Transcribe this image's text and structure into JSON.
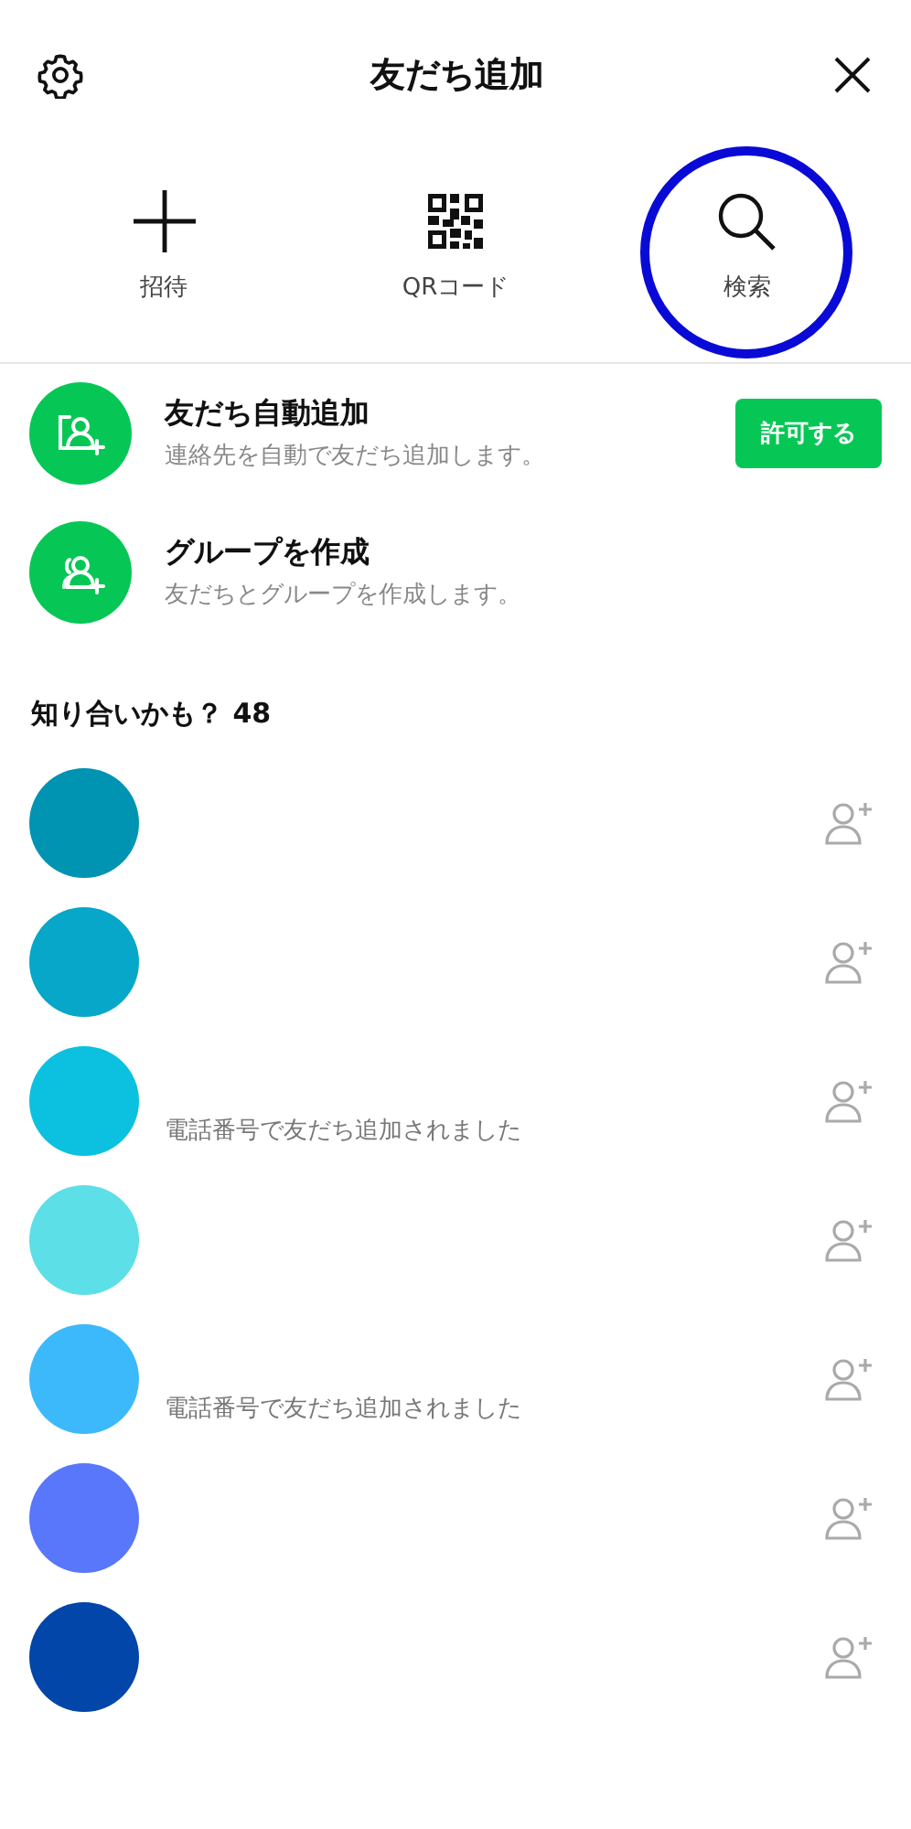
{
  "header": {
    "title": "友だち追加"
  },
  "actions": [
    {
      "kind": "invite",
      "label": "招待",
      "highlighted": false
    },
    {
      "kind": "qr",
      "label": "QRコード",
      "highlighted": false
    },
    {
      "kind": "search",
      "label": "検索",
      "highlighted": true
    }
  ],
  "features": [
    {
      "kind": "auto",
      "title": "友だち自動追加",
      "subtitle": "連絡先を自動で友だち追加します。",
      "button": "許可する"
    },
    {
      "kind": "group",
      "title": "グループを作成",
      "subtitle": "友だちとグループを作成します。"
    }
  ],
  "suggestions": {
    "title": "知り合いかも？ 48",
    "people": [
      {
        "color": "#0093b2"
      },
      {
        "color": "#06a7c8"
      },
      {
        "color": "#0bc1df",
        "note": "電話番号で友だち追加されました"
      },
      {
        "color": "#5cdfe6"
      },
      {
        "color": "#3cb9fa",
        "note": "電話番号で友だち追加されました"
      },
      {
        "color": "#5877fb"
      },
      {
        "color": "#0246a9"
      }
    ]
  }
}
